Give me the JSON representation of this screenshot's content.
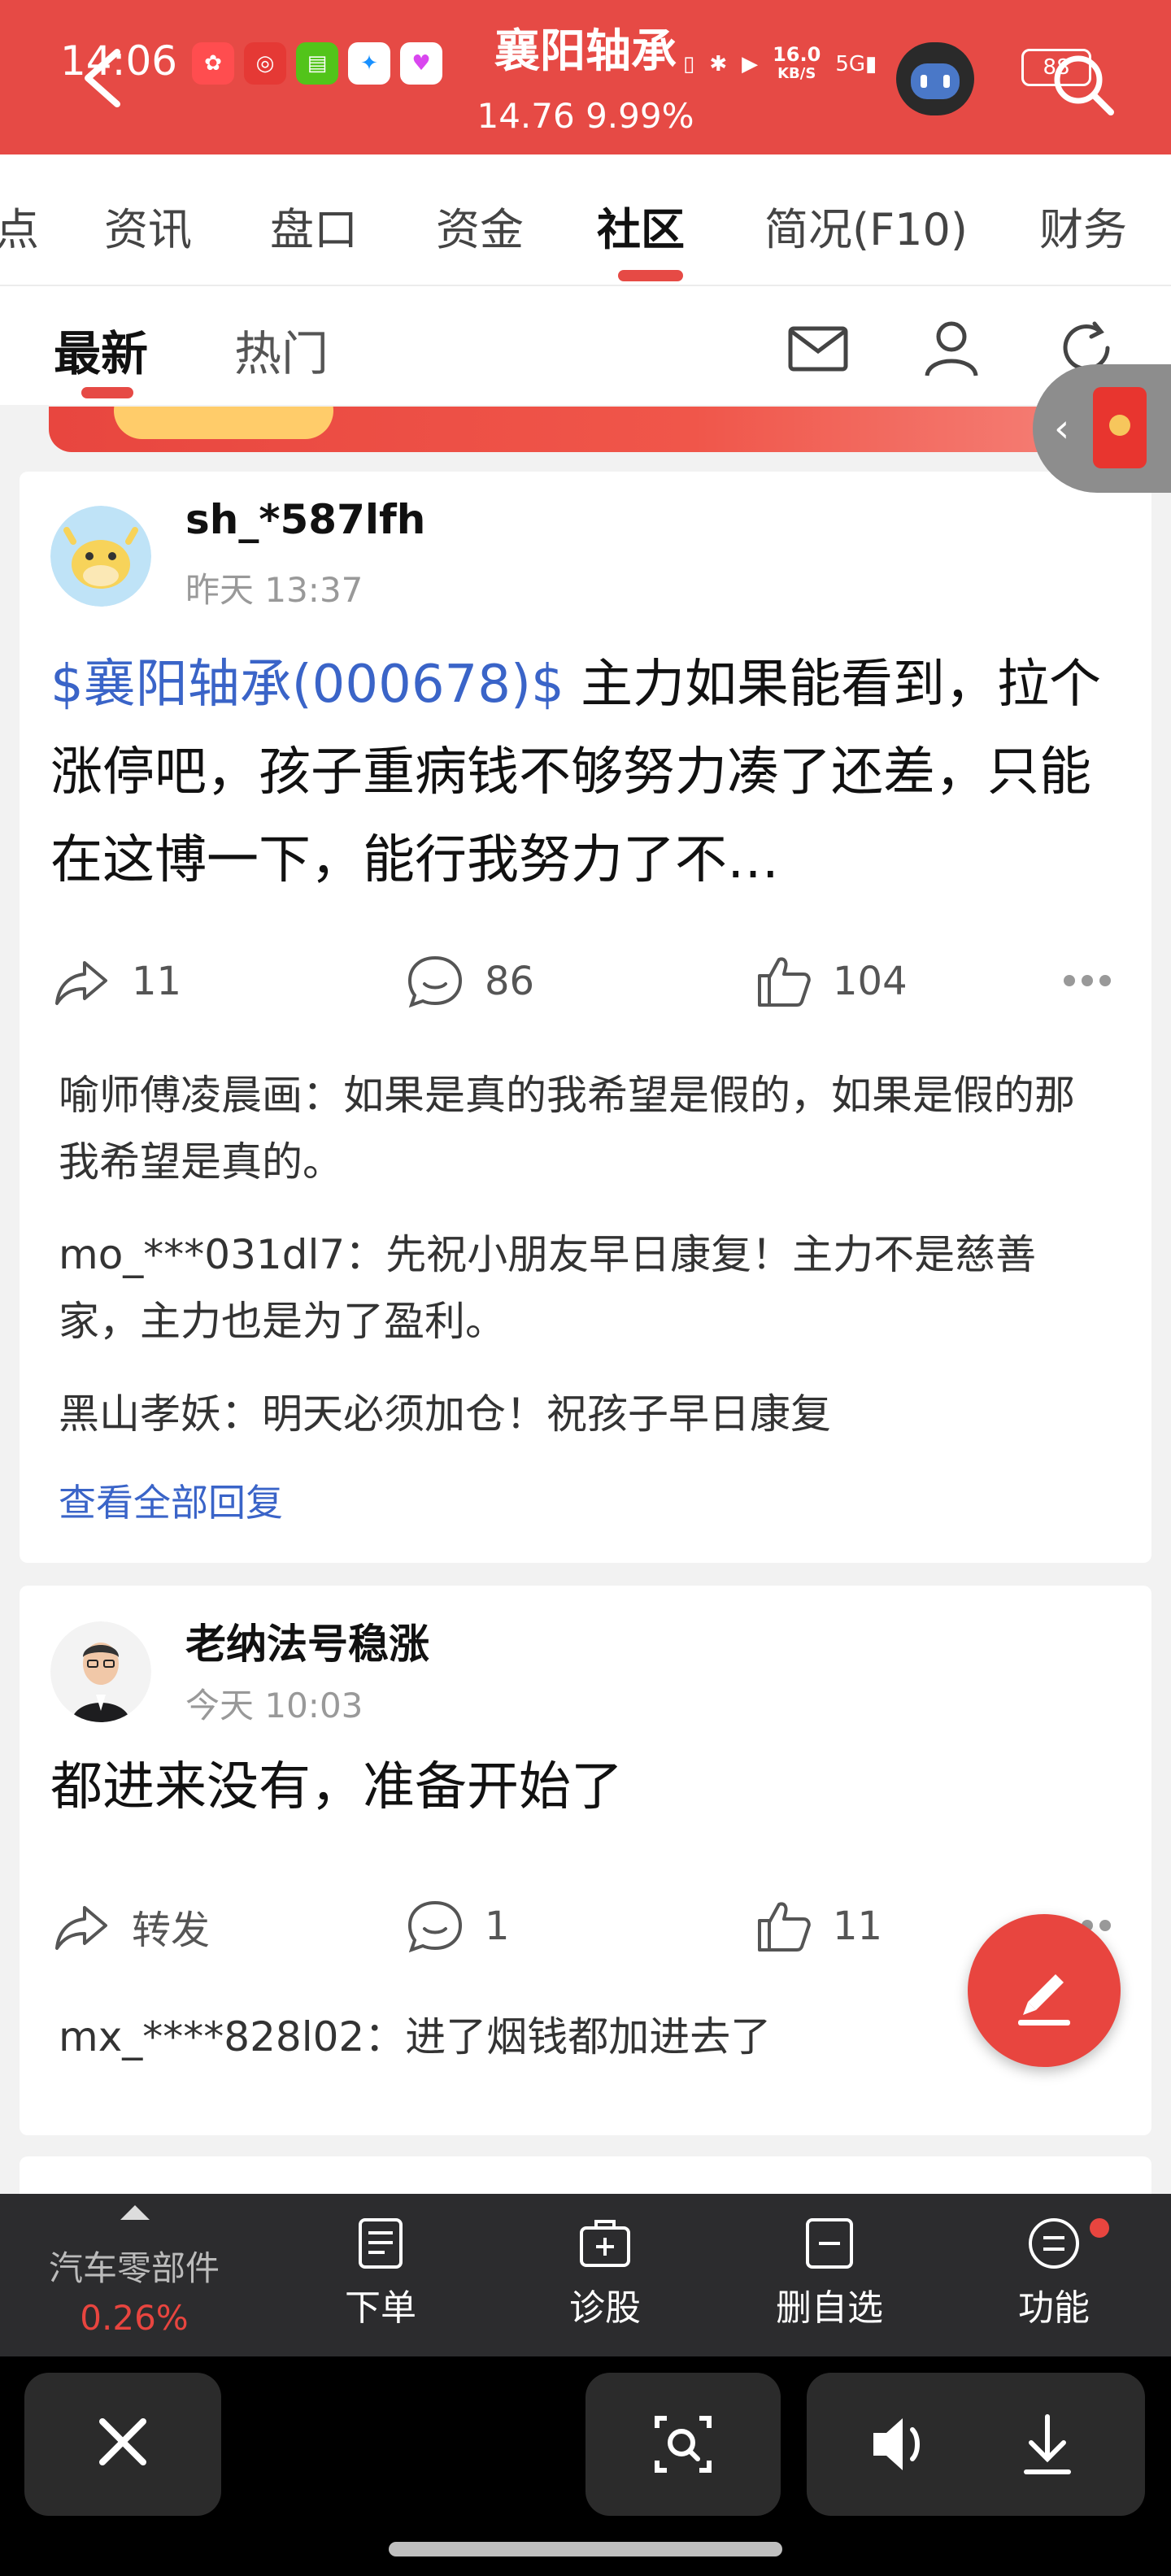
{
  "status_bar": {
    "time": "14:06",
    "net_speed_value": "16.0",
    "net_speed_unit": "KB/S",
    "battery": "88"
  },
  "header": {
    "title": "襄阳轴承",
    "price": "14.76",
    "change_pct": "9.99%"
  },
  "main_tabs": [
    "点",
    "资讯",
    "盘口",
    "资金",
    "社区",
    "简况(F10)",
    "财务"
  ],
  "main_tab_active": "社区",
  "sub_tabs": {
    "latest": "最新",
    "hot": "热门"
  },
  "posts": [
    {
      "username": "sh_*587lfh",
      "time": "昨天 13:37",
      "stock_tag": "$襄阳轴承(000678)$",
      "text": " 主力如果能看到，拉个涨停吧，孩子重病钱不够努力凑了还差，只能在这博一下，能行我努力了不…",
      "share_count": "11",
      "comment_count": "86",
      "like_count": "104",
      "replies": [
        {
          "author": "喻师傅凌晨画",
          "text": "如果是真的我希望是假的，如果是假的那我希望是真的。"
        },
        {
          "author": "mo_***031dl7",
          "text": "先祝小朋友早日康复！主力不是慈善家，主力也是为了盈利。"
        },
        {
          "author": "黑山孝妖",
          "text": "明天必须加仓！祝孩子早日康复"
        }
      ],
      "view_all": "查看全部回复"
    },
    {
      "username": "老纳法号稳涨",
      "time": "今天 10:03",
      "text": "都进来没有，准备开始了",
      "share_label": "转发",
      "comment_count": "1",
      "like_count": "11",
      "replies": [
        {
          "author": "mx_****828l02",
          "text": "进了烟钱都加进去了"
        }
      ]
    }
  ],
  "bottom_bar": {
    "sector_name": "汽车零部件",
    "sector_change": "0.26%",
    "items": [
      "下单",
      "诊股",
      "删自选",
      "功能"
    ]
  },
  "colors": {
    "brand_red": "#e64a45",
    "link_blue": "#3a64c8",
    "bottom_bar_bg": "#2c2c2e"
  }
}
